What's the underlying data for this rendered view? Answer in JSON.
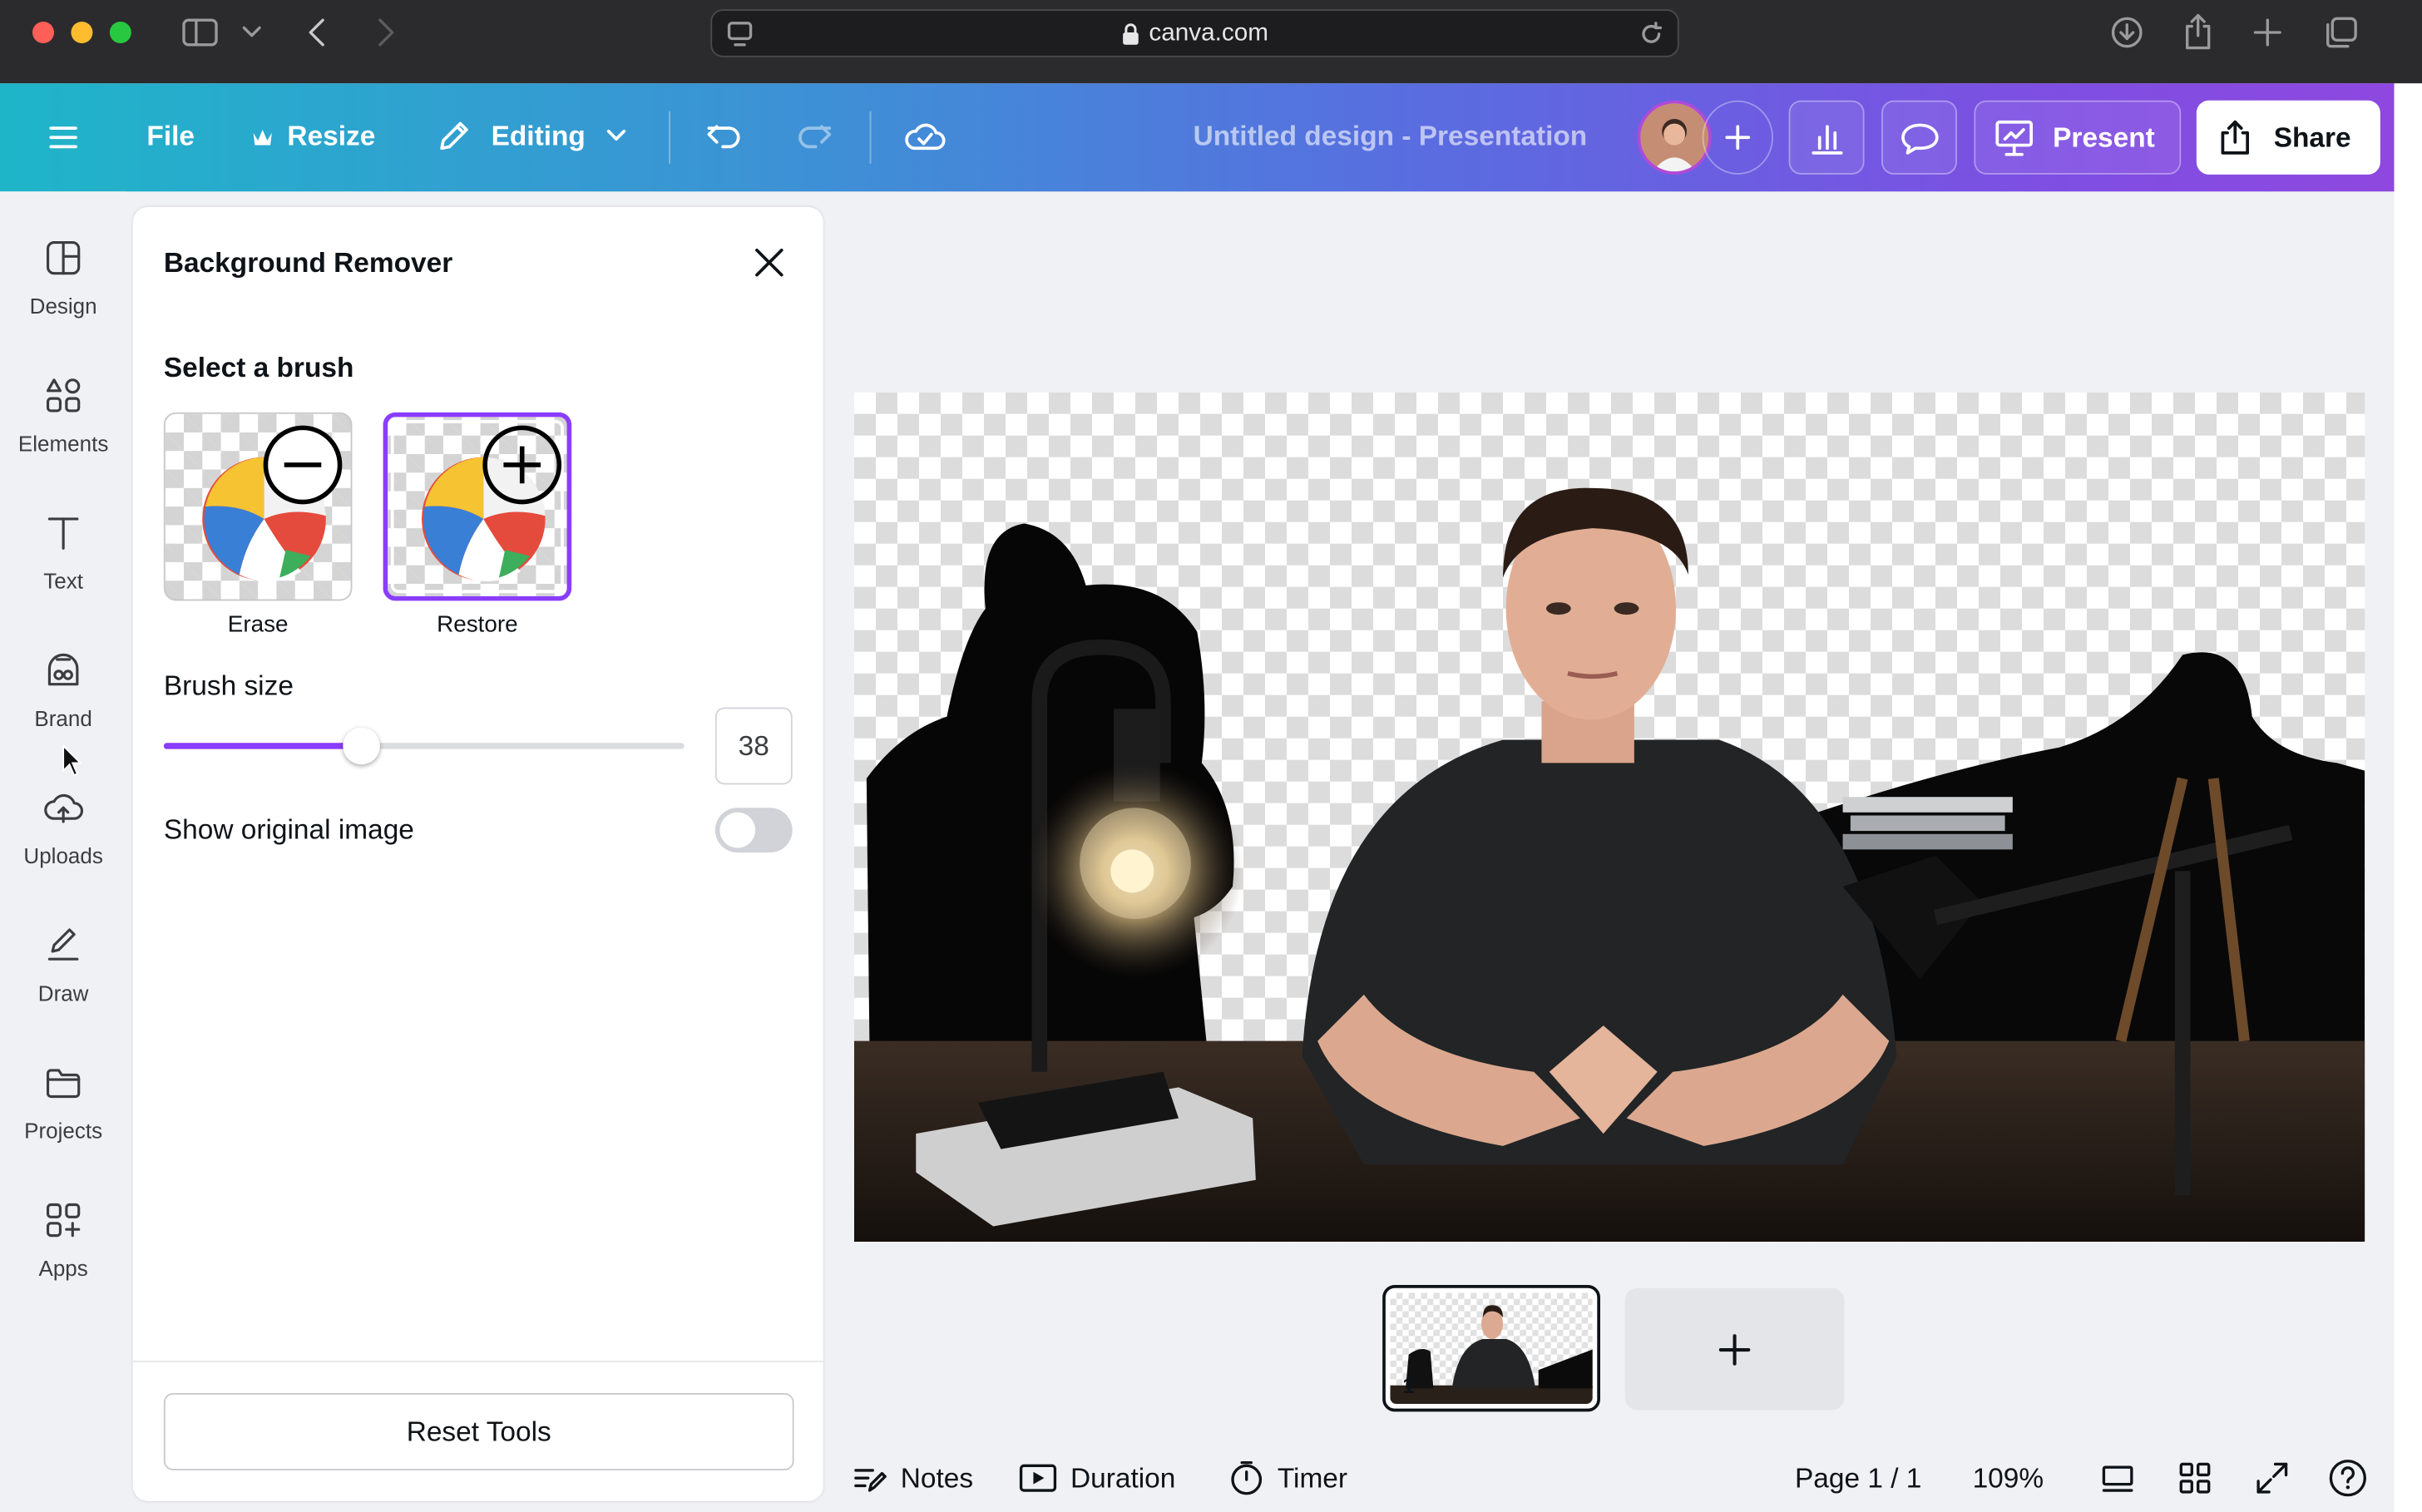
{
  "browser": {
    "url": "canva.com",
    "traffic_lights": [
      "#ff5f57",
      "#febc2e",
      "#28c840"
    ]
  },
  "header": {
    "menu_icon": "hamburger-menu-icon",
    "file_label": "File",
    "resize_label": "Resize",
    "editing_label": "Editing",
    "design_title": "Untitled design - Presentation",
    "present_label": "Present",
    "share_label": "Share"
  },
  "sidebar": {
    "items": [
      {
        "label": "Design",
        "icon": "design-icon"
      },
      {
        "label": "Elements",
        "icon": "elements-icon"
      },
      {
        "label": "Text",
        "icon": "text-icon"
      },
      {
        "label": "Brand",
        "icon": "brand-icon"
      },
      {
        "label": "Uploads",
        "icon": "uploads-icon"
      },
      {
        "label": "Draw",
        "icon": "draw-icon"
      },
      {
        "label": "Projects",
        "icon": "projects-icon"
      },
      {
        "label": "Apps",
        "icon": "apps-icon"
      }
    ]
  },
  "panel": {
    "title": "Background Remover",
    "select_brush_label": "Select a brush",
    "brushes": [
      {
        "label": "Erase",
        "selected": false
      },
      {
        "label": "Restore",
        "selected": true
      }
    ],
    "brush_size_label": "Brush size",
    "brush_size_value": "38",
    "brush_size_fraction": 0.38,
    "show_original_label": "Show original image",
    "show_original_on": false,
    "reset_label": "Reset Tools"
  },
  "pages": {
    "thumbnail_number": "1",
    "add_page_icon": "plus-icon"
  },
  "footer": {
    "notes_label": "Notes",
    "duration_label": "Duration",
    "timer_label": "Timer",
    "page_indicator": "Page 1 / 1",
    "zoom": "109%"
  },
  "colors": {
    "accent": "#8b3dff",
    "header_start": "#1fb5c9",
    "header_end": "#8e48e0"
  }
}
